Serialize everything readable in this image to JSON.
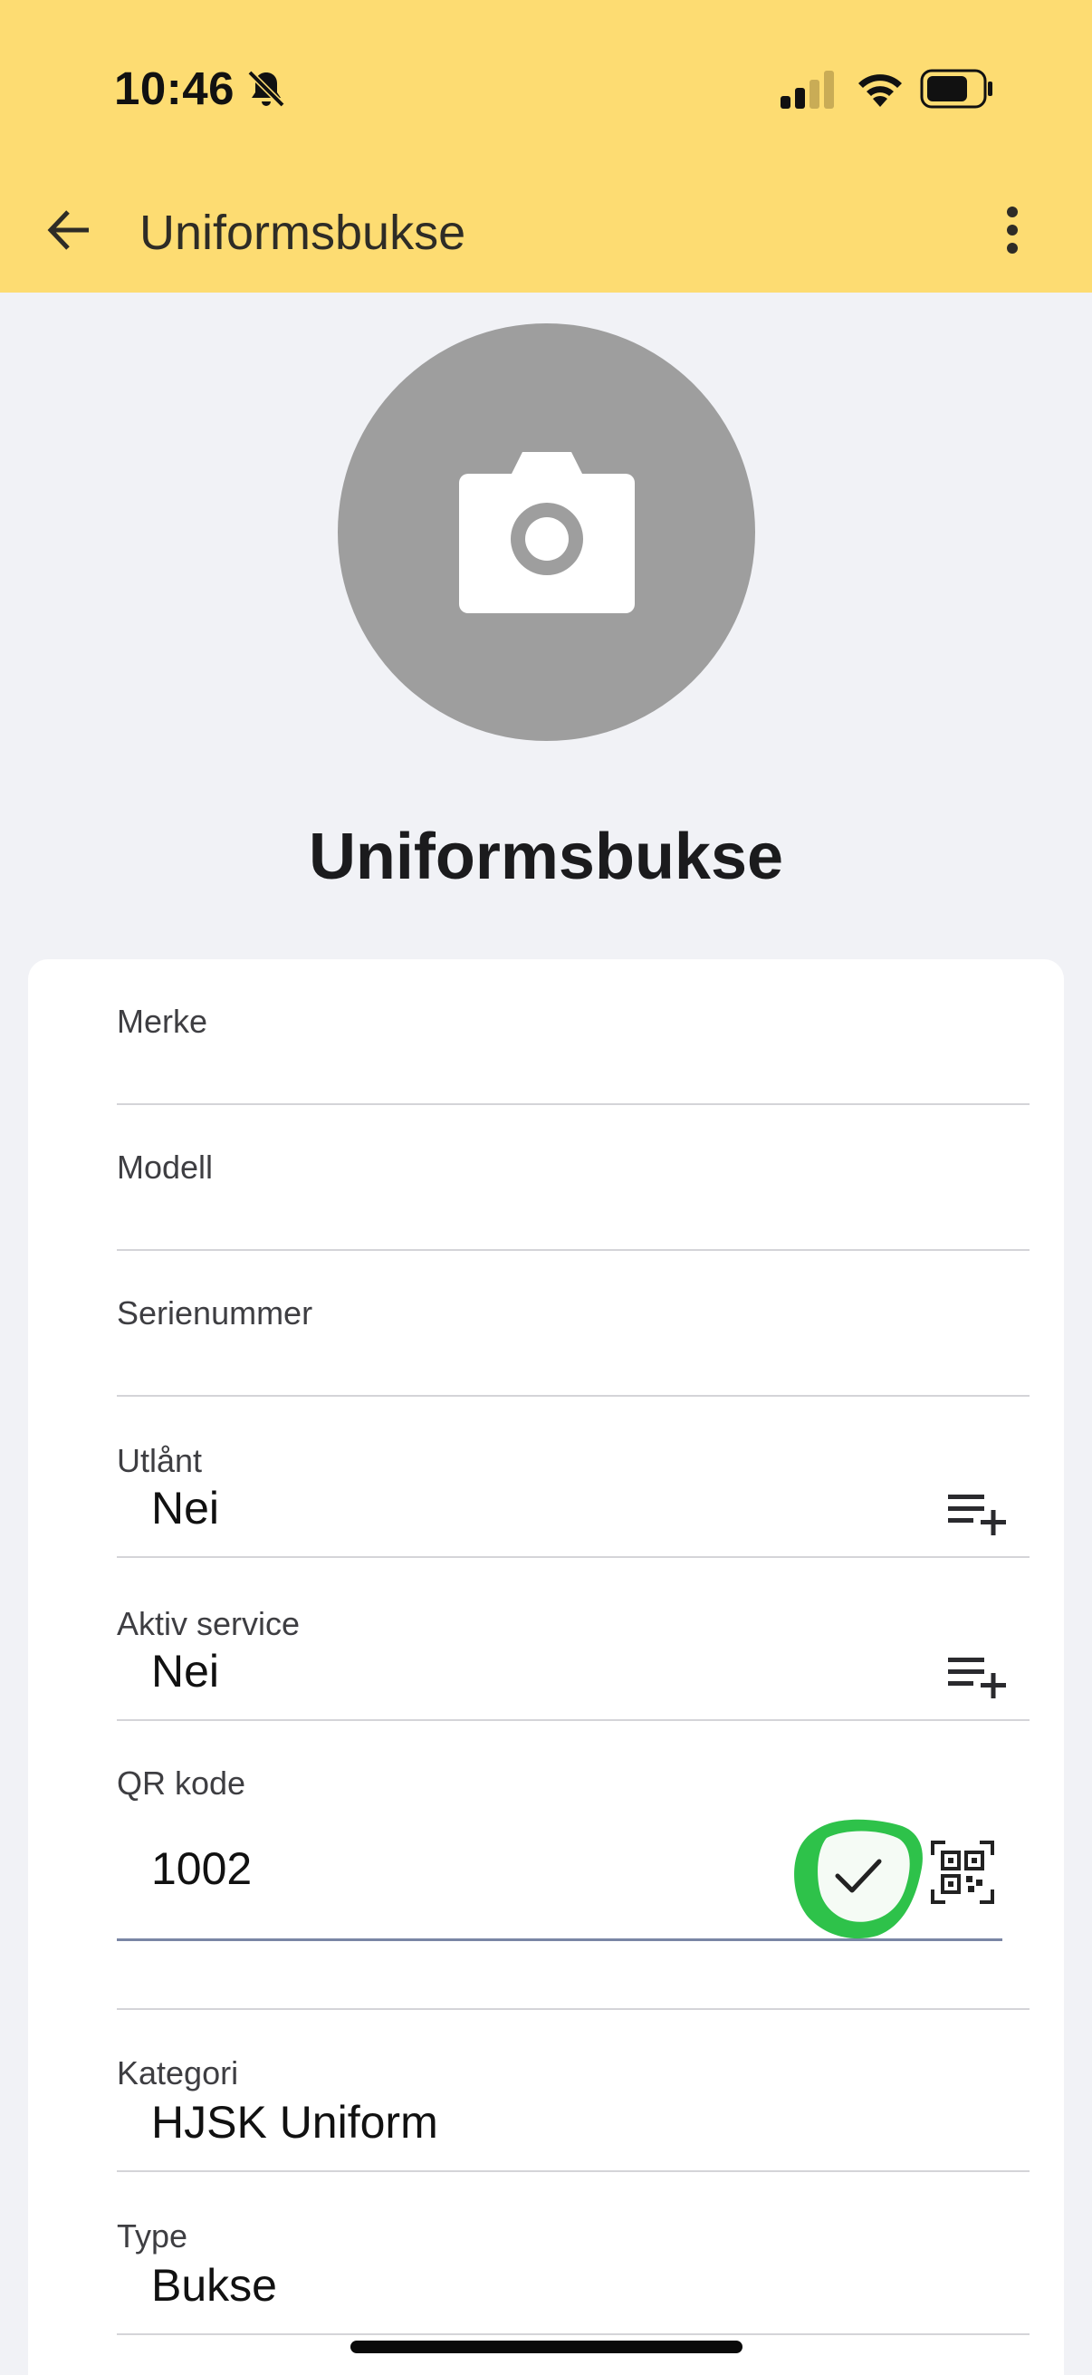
{
  "status_bar": {
    "time": "10:46"
  },
  "app_bar": {
    "title": "Uniformsbukse"
  },
  "item": {
    "heading": "Uniformsbukse"
  },
  "fields": {
    "brand": {
      "label": "Merke",
      "value": ""
    },
    "model": {
      "label": "Modell",
      "value": ""
    },
    "serial": {
      "label": "Serienummer",
      "value": ""
    },
    "loaned": {
      "label": "Utlånt",
      "value": "Nei"
    },
    "active_service": {
      "label": "Aktiv service",
      "value": "Nei"
    },
    "qr_code": {
      "label": "QR kode",
      "value": "1002"
    },
    "category": {
      "label": "Kategori",
      "value": "HJSK Uniform"
    },
    "type": {
      "label": "Type",
      "value": "Bukse"
    }
  },
  "icons": {
    "back": "arrow-left-icon",
    "more": "more-vertical-icon",
    "camera": "camera-icon",
    "add_list": "playlist-add-icon",
    "confirm": "check-icon",
    "scan": "qr-scan-icon"
  },
  "colors": {
    "app_bar": "#fddc72",
    "background": "#f1f2f6",
    "confirm_highlight": "#2ec24a"
  }
}
